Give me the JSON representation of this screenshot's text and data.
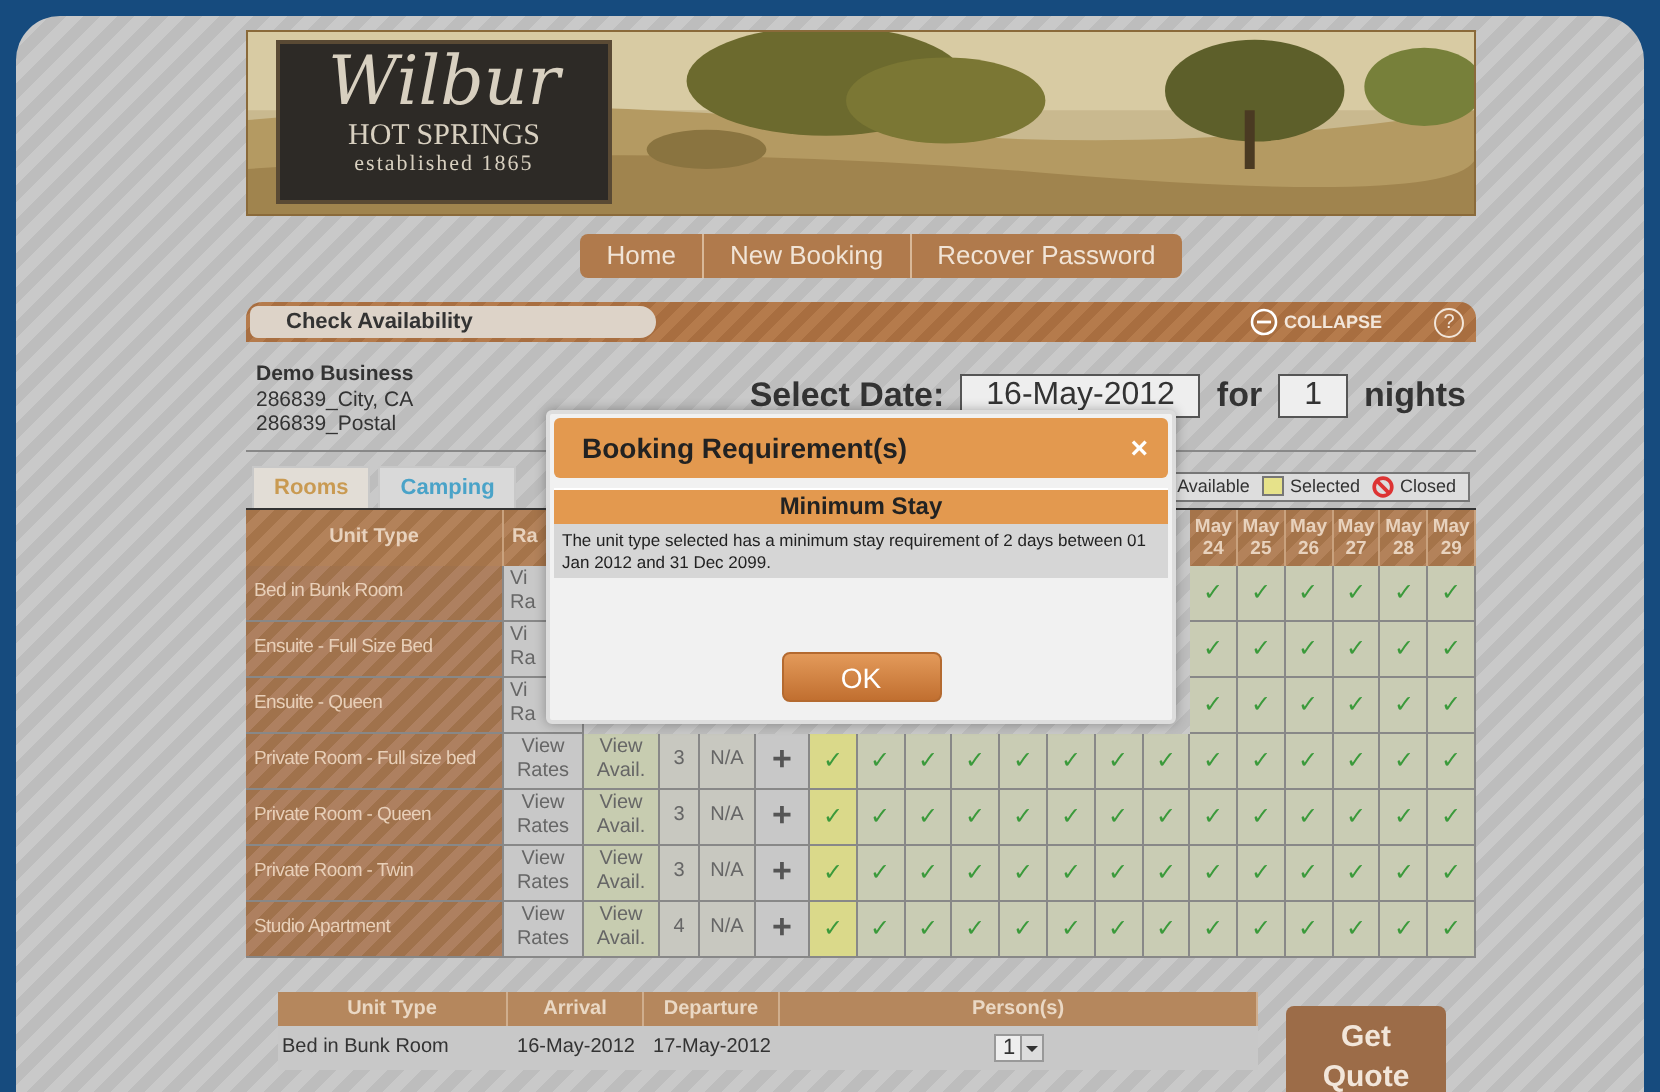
{
  "logo": {
    "name": "Wilbur",
    "subtitle": "HOT SPRINGS",
    "established": "established 1865"
  },
  "nav": [
    "Home",
    "New Booking",
    "Recover Password"
  ],
  "panel": {
    "title": "Check Availability",
    "collapse": "COLLAPSE",
    "help": "?"
  },
  "business": {
    "lines": [
      "Demo Business",
      "286839_City, CA",
      "286839_Postal"
    ]
  },
  "date_picker": {
    "label": "Select Date:",
    "date": "16-May-2012",
    "for": "for",
    "nights": "1",
    "unit": "nights"
  },
  "tabs": [
    {
      "label": "Rooms",
      "selected": true
    },
    {
      "label": "Camping",
      "selected": false
    }
  ],
  "legend": [
    {
      "kind": "available",
      "label": "Available"
    },
    {
      "kind": "selected",
      "label": "Selected"
    },
    {
      "kind": "closed",
      "label": "Closed"
    }
  ],
  "grid": {
    "columns": [
      "Unit Type",
      "Ra"
    ],
    "day_headers": [
      {
        "month": "May",
        "day": "24"
      },
      {
        "month": "May",
        "day": "25"
      },
      {
        "month": "May",
        "day": "26"
      },
      {
        "month": "May",
        "day": "27"
      },
      {
        "month": "May",
        "day": "28"
      },
      {
        "month": "May",
        "day": "29"
      }
    ],
    "rows": [
      {
        "unit_type": "Bed in Bunk Room",
        "rates": "Vi Ra",
        "days": [
          {
            "mark": "✓",
            "selected": false
          },
          {
            "mark": "✓",
            "selected": false
          },
          {
            "mark": "✓",
            "selected": false
          },
          {
            "mark": "✓",
            "selected": false
          },
          {
            "mark": "✓",
            "selected": false
          },
          {
            "mark": "✓",
            "selected": false
          }
        ]
      },
      {
        "unit_type": "Ensuite - Full Size Bed",
        "rates": "Vi Ra",
        "days": [
          {
            "mark": "✓",
            "selected": false
          },
          {
            "mark": "✓",
            "selected": false
          },
          {
            "mark": "✓",
            "selected": false
          },
          {
            "mark": "✓",
            "selected": false
          },
          {
            "mark": "✓",
            "selected": false
          },
          {
            "mark": "✓",
            "selected": false
          }
        ]
      },
      {
        "unit_type": "Ensuite - Queen",
        "rates": "Vi Ra",
        "days": [
          {
            "mark": "✓",
            "selected": false
          },
          {
            "mark": "✓",
            "selected": false
          },
          {
            "mark": "✓",
            "selected": false
          },
          {
            "mark": "✓",
            "selected": false
          },
          {
            "mark": "✓",
            "selected": false
          },
          {
            "mark": "✓",
            "selected": false
          }
        ]
      },
      {
        "unit_type": "Private Room - Full size bed",
        "rates": "View Rates",
        "avail": "View Avail.",
        "units": "3",
        "extra": "N/A",
        "add": "+",
        "days": [
          {
            "mark": "✓",
            "selected": true
          },
          {
            "mark": "✓",
            "selected": false
          },
          {
            "mark": "✓",
            "selected": false
          },
          {
            "mark": "✓",
            "selected": false
          },
          {
            "mark": "✓",
            "selected": false
          },
          {
            "mark": "✓",
            "selected": false
          },
          {
            "mark": "✓",
            "selected": false
          },
          {
            "mark": "✓",
            "selected": false
          },
          {
            "mark": "✓",
            "selected": false
          },
          {
            "mark": "✓",
            "selected": false
          },
          {
            "mark": "✓",
            "selected": false
          },
          {
            "mark": "✓",
            "selected": false
          },
          {
            "mark": "✓",
            "selected": false
          },
          {
            "mark": "✓",
            "selected": false
          }
        ]
      },
      {
        "unit_type": "Private Room - Queen",
        "rates": "View Rates",
        "avail": "View Avail.",
        "units": "3",
        "extra": "N/A",
        "add": "+",
        "days": [
          {
            "mark": "✓",
            "selected": true
          },
          {
            "mark": "✓",
            "selected": false
          },
          {
            "mark": "✓",
            "selected": false
          },
          {
            "mark": "✓",
            "selected": false
          },
          {
            "mark": "✓",
            "selected": false
          },
          {
            "mark": "✓",
            "selected": false
          },
          {
            "mark": "✓",
            "selected": false
          },
          {
            "mark": "✓",
            "selected": false
          },
          {
            "mark": "✓",
            "selected": false
          },
          {
            "mark": "✓",
            "selected": false
          },
          {
            "mark": "✓",
            "selected": false
          },
          {
            "mark": "✓",
            "selected": false
          },
          {
            "mark": "✓",
            "selected": false
          },
          {
            "mark": "✓",
            "selected": false
          }
        ]
      },
      {
        "unit_type": "Private Room - Twin",
        "rates": "View Rates",
        "avail": "View Avail.",
        "units": "3",
        "extra": "N/A",
        "add": "+",
        "days": [
          {
            "mark": "✓",
            "selected": true
          },
          {
            "mark": "✓",
            "selected": false
          },
          {
            "mark": "✓",
            "selected": false
          },
          {
            "mark": "✓",
            "selected": false
          },
          {
            "mark": "✓",
            "selected": false
          },
          {
            "mark": "✓",
            "selected": false
          },
          {
            "mark": "✓",
            "selected": false
          },
          {
            "mark": "✓",
            "selected": false
          },
          {
            "mark": "✓",
            "selected": false
          },
          {
            "mark": "✓",
            "selected": false
          },
          {
            "mark": "✓",
            "selected": false
          },
          {
            "mark": "✓",
            "selected": false
          },
          {
            "mark": "✓",
            "selected": false
          },
          {
            "mark": "✓",
            "selected": false
          }
        ]
      },
      {
        "unit_type": "Studio Apartment",
        "rates": "View Rates",
        "avail": "View Avail.",
        "units": "4",
        "extra": "N/A",
        "add": "+",
        "days": [
          {
            "mark": "✓",
            "selected": true
          },
          {
            "mark": "✓",
            "selected": false
          },
          {
            "mark": "✓",
            "selected": false
          },
          {
            "mark": "✓",
            "selected": false
          },
          {
            "mark": "✓",
            "selected": false
          },
          {
            "mark": "✓",
            "selected": false
          },
          {
            "mark": "✓",
            "selected": false
          },
          {
            "mark": "✓",
            "selected": false
          },
          {
            "mark": "✓",
            "selected": false
          },
          {
            "mark": "✓",
            "selected": false
          },
          {
            "mark": "✓",
            "selected": false
          },
          {
            "mark": "✓",
            "selected": false
          },
          {
            "mark": "✓",
            "selected": false
          },
          {
            "mark": "✓",
            "selected": false
          }
        ]
      }
    ]
  },
  "quote": {
    "columns": [
      "Unit Type",
      "Arrival",
      "Departure",
      "Person(s)"
    ],
    "rows": [
      {
        "unit_type": "Bed in Bunk Room",
        "arrival": "16-May-2012",
        "departure": "17-May-2012",
        "persons": "1"
      }
    ],
    "button": "Get Quote"
  },
  "dialog": {
    "title": "Booking Requirement(s)",
    "close": "×",
    "heading": "Minimum Stay",
    "message": "The unit type selected has a minimum stay requirement of 2 days between 01 Jan 2012 and 31 Dec 2099.",
    "ok": "OK"
  }
}
